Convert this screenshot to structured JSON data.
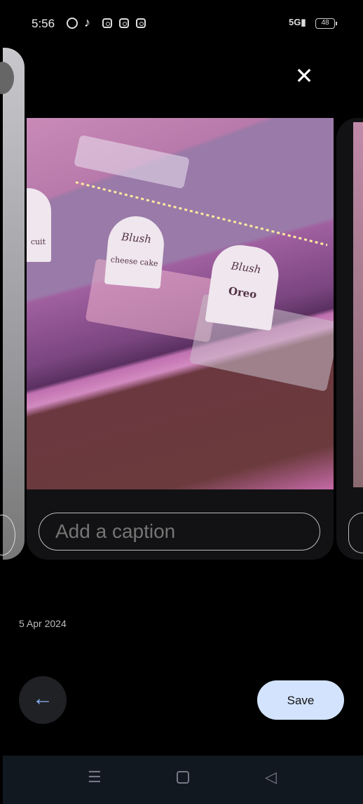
{
  "status_bar": {
    "time": "5:56",
    "notification_icons": [
      "whatsapp-icon",
      "tiktok-icon",
      "instagram-icon",
      "instagram-icon",
      "instagram-icon"
    ],
    "network": "5G",
    "battery": "48"
  },
  "header": {
    "close_icon": "close-icon"
  },
  "photo": {
    "sign_texts": [
      "Blush",
      "cheese cake",
      "Blush",
      "Oreo",
      "cuit"
    ]
  },
  "caption": {
    "placeholder": "Add a caption",
    "value": ""
  },
  "date": "5 Apr 2024",
  "actions": {
    "back_icon": "arrow-left-icon",
    "save_label": "Save",
    "accent": "#d3e3fd",
    "back_icon_color": "#8ab4f8"
  },
  "nav_bar": {
    "icons": [
      "menu-icon",
      "home-icon",
      "back-icon"
    ]
  }
}
